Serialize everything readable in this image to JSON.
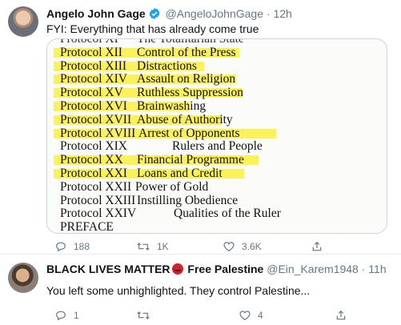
{
  "tweets": [
    {
      "author": "Angelo John Gage",
      "handle": "@AngeloJohnGage",
      "time": "· 12h",
      "text": "FYI: Everything that has already come true",
      "media_lines": [
        {
          "c1": "Protocol XI",
          "c2": "The Totalitarian State",
          "highlight": false,
          "cut": true
        },
        {
          "c1": "Protocol XII",
          "c2": "Control of the Press",
          "highlight": true
        },
        {
          "c1": "Protocol XIII",
          "c2": "Distractions",
          "highlight": true
        },
        {
          "c1": "Protocol XIV",
          "c2": "Assault on Religion",
          "highlight": true
        },
        {
          "c1": "Protocol XV",
          "c2": "Ruthless Suppression",
          "highlight": true
        },
        {
          "c1": "Protocol XVI",
          "c2": "Brainwashing",
          "highlight": true
        },
        {
          "c1": "Protocol XVII",
          "c2": "Abuse of Authority",
          "highlight": true
        },
        {
          "c1": "Protocol XVIII",
          "c2": "Arrest of Opponents",
          "highlight": true
        },
        {
          "c1": "Protocol XIX",
          "c2": "Rulers and People",
          "highlight": false
        },
        {
          "c1": "Protocol XX",
          "c2": "Financial Programme",
          "highlight": true
        },
        {
          "c1": "Protocol XXI",
          "c2": "Loans and Credit",
          "highlight": true
        },
        {
          "c1": "Protocol XXII",
          "c2": "Power of Gold",
          "highlight": false
        },
        {
          "c1": "Protocol XXIII",
          "c2": "Instilling Obedience",
          "highlight": false
        },
        {
          "c1": "Protocol XXIV",
          "c2": "Qualities of the Ruler",
          "highlight": false
        },
        {
          "c1": "PREFACE",
          "c2": "",
          "highlight": false
        }
      ],
      "replies": "188",
      "retweets": "1K",
      "likes": "3.6K"
    },
    {
      "author_part1": "BLACK LIVES MATTER",
      "author_part2": "Free Palestine",
      "handle": "@Ein_Karem1948",
      "time": "· 11h",
      "text": "You left some unhighlighted. They control Palestine...",
      "replies": "1",
      "retweets": "",
      "likes": "4"
    }
  ],
  "colors": {
    "highlight": "#fbf15a",
    "verified": "#1da1f2",
    "muted": "#657786",
    "border": "#e6ecf0"
  },
  "icons": [
    "verified-badge-icon",
    "angry-face-emoji-icon",
    "reply-icon",
    "retweet-icon",
    "like-icon",
    "share-icon"
  ]
}
